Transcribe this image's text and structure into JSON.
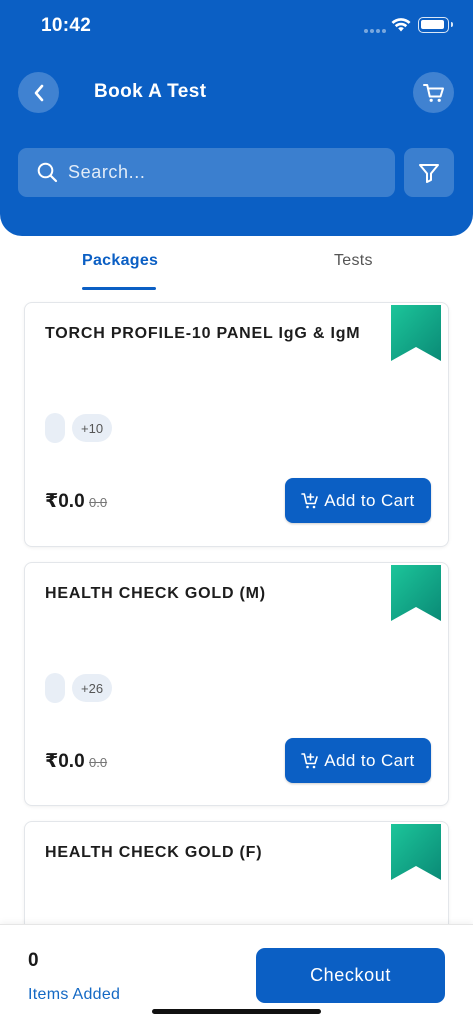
{
  "status_bar": {
    "time": "10:42"
  },
  "header": {
    "title": "Book A Test"
  },
  "search": {
    "placeholder": "Search..."
  },
  "tabs": [
    {
      "label": "Packages",
      "active": true
    },
    {
      "label": "Tests",
      "active": false
    }
  ],
  "packages": [
    {
      "name": "TORCH PROFILE-10 PANEL IgG & IgM",
      "more_tests": "+10",
      "price": "₹0.0",
      "old_price": "0.0",
      "add_label": "Add to Cart"
    },
    {
      "name": "HEALTH CHECK GOLD (M)",
      "more_tests": "+26",
      "price": "₹0.0",
      "old_price": "0.0",
      "add_label": "Add to Cart"
    },
    {
      "name": "HEALTH CHECK GOLD (F)"
    }
  ],
  "footer": {
    "count": "0",
    "items_label": "Items Added",
    "checkout_label": "Checkout"
  },
  "colors": {
    "primary": "#0b5fc4",
    "ribbon_start": "#1cc59a",
    "ribbon_end": "#0a8a76"
  },
  "icons": [
    "back-arrow-icon",
    "cart-icon",
    "search-icon",
    "filter-icon",
    "ribbon-icon",
    "add-to-cart-icon"
  ]
}
